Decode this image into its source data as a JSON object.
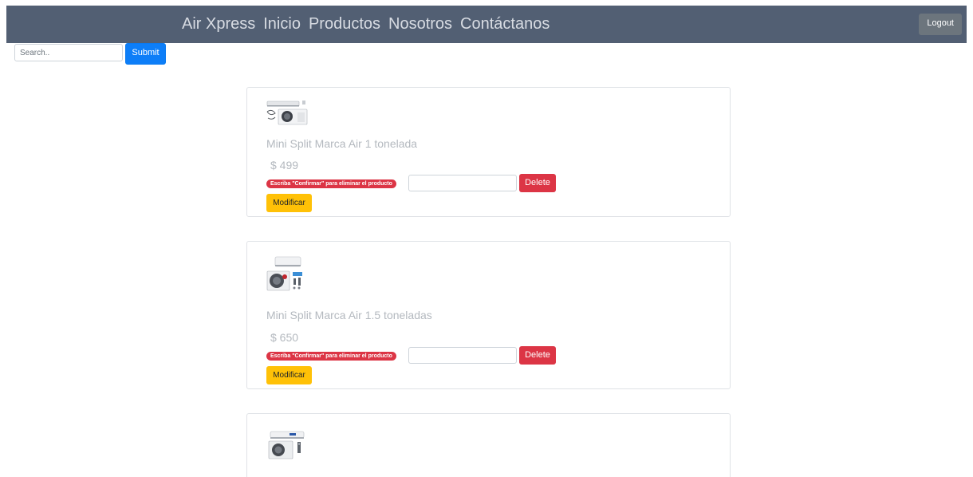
{
  "nav": {
    "brand": "Air Xpress",
    "links": [
      "Inicio",
      "Productos",
      "Nosotros",
      "Contáctanos"
    ],
    "logout_label": "Logout"
  },
  "search": {
    "placeholder": "Search..",
    "value": "",
    "submit_label": "Submit"
  },
  "products": [
    {
      "name": "Mini Split Marca Air 1 tonelada",
      "price": "$ 499",
      "confirm_hint": "Escriba \"Confirmar\" para eliminar el producto",
      "delete_label": "Delete",
      "modify_label": "Modificar"
    },
    {
      "name": "Mini Split Marca Air 1.5 toneladas",
      "price": "$ 650",
      "confirm_hint": "Escriba \"Confirmar\" para eliminar el producto",
      "delete_label": "Delete",
      "modify_label": "Modificar"
    },
    {
      "name": "",
      "price": ""
    }
  ],
  "colors": {
    "navbar_bg": "#525f73",
    "primary": "#0d7ef8",
    "danger": "#dc3545",
    "warning": "#ffc107",
    "secondary": "#6c757d"
  }
}
